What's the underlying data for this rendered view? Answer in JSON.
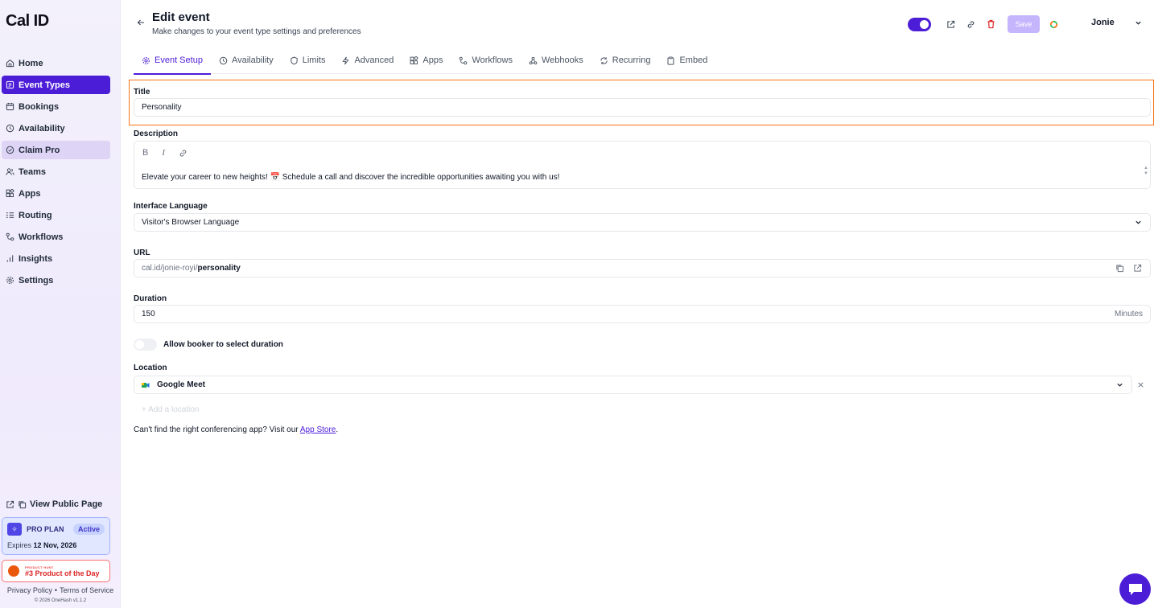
{
  "sidebar": {
    "logo": "Cal ID",
    "items": [
      {
        "label": "Home",
        "icon": "home-icon"
      },
      {
        "label": "Event Types",
        "icon": "event-types-icon",
        "active": true
      },
      {
        "label": "Bookings",
        "icon": "calendar-icon"
      },
      {
        "label": "Availability",
        "icon": "clock-icon"
      },
      {
        "label": "Claim Pro",
        "icon": "claim-icon"
      },
      {
        "label": "Teams",
        "icon": "users-icon"
      },
      {
        "label": "Apps",
        "icon": "apps-icon"
      },
      {
        "label": "Routing",
        "icon": "routing-icon"
      },
      {
        "label": "Workflows",
        "icon": "workflow-icon"
      },
      {
        "label": "Insights",
        "icon": "chart-icon"
      },
      {
        "label": "Settings",
        "icon": "gear-icon"
      }
    ],
    "public_page": "View Public Page",
    "plan": {
      "label": "PRO PLAN",
      "status": "Active",
      "expires_prefix": "Expires",
      "expires_date": "12 Nov, 2026"
    },
    "product_hunt": {
      "small": "PRODUCT HUNT",
      "big": "#3 Product of the Day"
    },
    "legal": {
      "privacy": "Privacy Policy",
      "terms": "Terms of Service"
    },
    "copyright": "© 2026 OneHash v1.1.2"
  },
  "header": {
    "title": "Edit event",
    "subtitle": "Make changes to your event type settings and preferences",
    "save_label": "Save",
    "user_name": "Jonie"
  },
  "tabs": [
    {
      "label": "Event Setup",
      "icon": "gear-icon",
      "active": true
    },
    {
      "label": "Availability",
      "icon": "clock-icon"
    },
    {
      "label": "Limits",
      "icon": "shield-icon"
    },
    {
      "label": "Advanced",
      "icon": "bolt-icon"
    },
    {
      "label": "Apps",
      "icon": "apps-icon"
    },
    {
      "label": "Workflows",
      "icon": "workflow-icon"
    },
    {
      "label": "Webhooks",
      "icon": "webhook-icon"
    },
    {
      "label": "Recurring",
      "icon": "repeat-icon"
    },
    {
      "label": "Embed",
      "icon": "clipboard-icon"
    }
  ],
  "form": {
    "title_label": "Title",
    "title_value": "Personality",
    "description_label": "Description",
    "description_value": "Elevate your career to new heights! 📅 Schedule a call and discover the incredible opportunities awaiting you with us!",
    "language_label": "Interface Language",
    "language_value": "Visitor's Browser Language",
    "url_label": "URL",
    "url_prefix": "cal.id/jonie-royi/",
    "url_slug": "personality",
    "duration_label": "Duration",
    "duration_value": "150",
    "duration_suffix": "Minutes",
    "allow_duration_label": "Allow booker to select duration",
    "location_label": "Location",
    "location_value": "Google Meet",
    "add_location": "+ Add a location",
    "help_prefix": "Can't find the right conferencing app? Visit our",
    "help_link": "App Store",
    "help_suffix": "."
  },
  "colors": {
    "accent": "#4c1dd7",
    "highlight": "#f97316",
    "danger": "#dc2626"
  }
}
